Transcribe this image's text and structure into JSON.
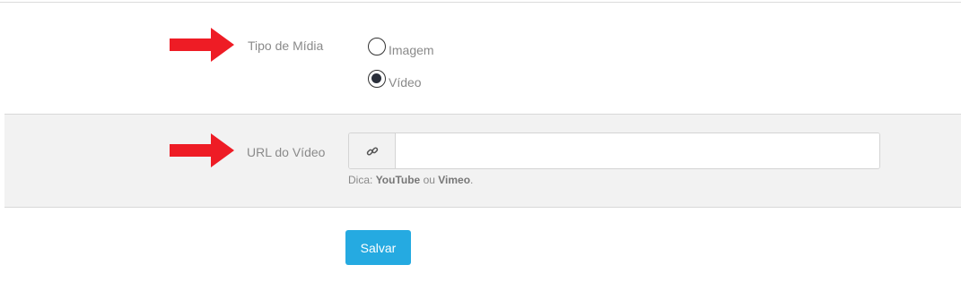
{
  "media_type": {
    "label": "Tipo de Mídia",
    "options": [
      {
        "label": "Imagem",
        "selected": false
      },
      {
        "label": "Vídeo",
        "selected": true
      }
    ]
  },
  "video_url": {
    "label": "URL do Vídeo",
    "addon_icon": "link-icon",
    "value": "",
    "hint_prefix": "Dica: ",
    "hint_strong_1": "YouTube",
    "hint_middle": " ou ",
    "hint_strong_2": "Vimeo",
    "hint_suffix": "."
  },
  "actions": {
    "save_label": "Salvar"
  },
  "colors": {
    "arrow": "#ee1c25",
    "primary_button": "#25aae1",
    "row_alt_background": "#f2f2f2"
  }
}
